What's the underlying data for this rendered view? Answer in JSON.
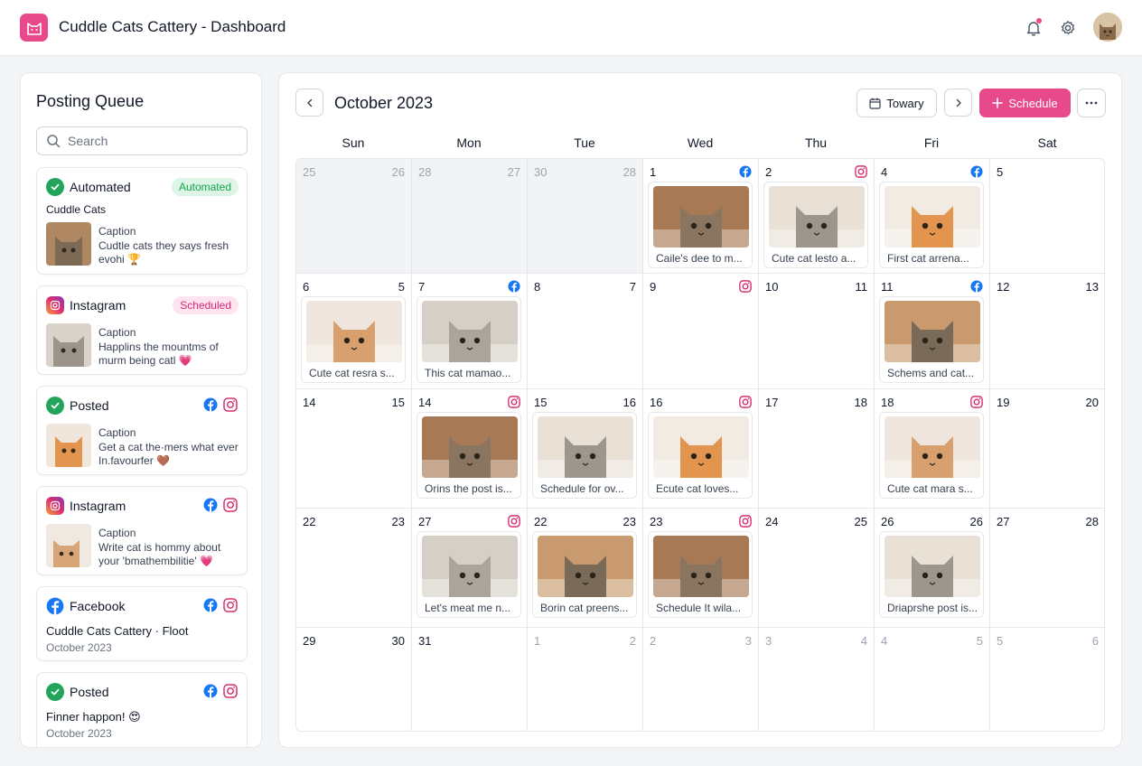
{
  "header": {
    "title": "Cuddle Cats Cattery - Dashboard",
    "logo_icon": "cat-logo-icon",
    "icons": [
      "bell-icon",
      "gear-icon"
    ],
    "accent": "#e8498a"
  },
  "queue": {
    "title": "Posting Queue",
    "search_placeholder": "Search",
    "cards": [
      {
        "status": "Automated",
        "badge": "Automated",
        "subtitle": "Cuddle Cats",
        "caption_label": "Caption",
        "caption": "Cudtle cats they says fresh evohi 🏆"
      },
      {
        "status": "Instagram",
        "badge": "Scheduled",
        "caption_label": "Caption",
        "caption": "Happlins the mountms of murm being catl 💗"
      },
      {
        "status": "Posted",
        "caption_label": "Caption",
        "caption": "Get a cat the·mers what ever In.favourfer 🤎"
      },
      {
        "status": "Instagram",
        "caption_label": "Caption",
        "caption": "Write cat is hommy about your 'bmathembilitie' 💗"
      },
      {
        "status": "Facebook",
        "line1": "Cuddle Cats Cattery · Floot",
        "line2": "October 2023"
      },
      {
        "status": "Posted",
        "line1": "Finner happon! 😍",
        "line2": "October 2023"
      }
    ]
  },
  "calendar": {
    "month": "October 2023",
    "today_label": "Towary",
    "schedule_label": "Schedule",
    "weekdays": [
      "Sun",
      "Mon",
      "Tue",
      "Wed",
      "Thu",
      "Fri",
      "Sat"
    ],
    "weeks": [
      [
        {
          "d1": "25",
          "d2": "26",
          "prev": true
        },
        {
          "d1": "28",
          "d2": "27",
          "prev": true
        },
        {
          "d1": "30",
          "d2": "28",
          "prev": true
        },
        {
          "d1": "1",
          "icon": "facebook-icon",
          "caption": "Caile's dee to m..."
        },
        {
          "d1": "2",
          "icon": "instagram-icon",
          "caption": "Cute cat lesto a..."
        },
        {
          "d1": "4",
          "icon": "facebook-icon",
          "caption": "First cat arrena..."
        },
        {
          "d1": "5"
        }
      ],
      [
        {
          "d1": "6",
          "d2": "5",
          "caption": "Cute cat resra s..."
        },
        {
          "d1": "7",
          "icon": "facebook-icon",
          "caption": "This cat mamao..."
        },
        {
          "d1": "8",
          "d2": "7"
        },
        {
          "d1": "9",
          "icon": "instagram-icon"
        },
        {
          "d1": "10",
          "d2": "11"
        },
        {
          "d1": "11",
          "icon": "facebook-icon",
          "caption": "Schems and cat..."
        },
        {
          "d1": "12",
          "d2": "13"
        }
      ],
      [
        {
          "d1": "14",
          "d2": "15"
        },
        {
          "d1": "14",
          "icon": "instagram-icon",
          "caption": "Orins the post is..."
        },
        {
          "d1": "15",
          "d2": "16",
          "caption": "Schedule for ov..."
        },
        {
          "d1": "16",
          "icon": "instagram-icon",
          "caption": "Ecute cat loves..."
        },
        {
          "d1": "17",
          "d2": "18"
        },
        {
          "d1": "18",
          "icon": "instagram-icon",
          "caption": "Cute cat mara s..."
        },
        {
          "d1": "19",
          "d2": "20"
        }
      ],
      [
        {
          "d1": "22",
          "d2": "23"
        },
        {
          "d1": "27",
          "icon": "instagram-icon",
          "caption": "Let's meat me n..."
        },
        {
          "d1": "22",
          "d2": "23",
          "caption": "Borin cat preens..."
        },
        {
          "d1": "23",
          "icon": "instagram-icon",
          "caption": "Schedule It wila..."
        },
        {
          "d1": "24",
          "d2": "25"
        },
        {
          "d1": "26",
          "d2": "26",
          "caption": "Driaprshe post is..."
        },
        {
          "d1": "27",
          "d2": "28"
        }
      ],
      [
        {
          "d1": "29",
          "d2": "30"
        },
        {
          "d1": "31"
        },
        {
          "d1": "1",
          "d2": "2",
          "muted": true
        },
        {
          "d1": "2",
          "d2": "3",
          "muted": true
        },
        {
          "d1": "3",
          "d2": "4",
          "muted": true
        },
        {
          "d1": "4",
          "d2": "5",
          "muted": true
        },
        {
          "d1": "5",
          "d2": "6",
          "muted": true
        }
      ]
    ]
  }
}
